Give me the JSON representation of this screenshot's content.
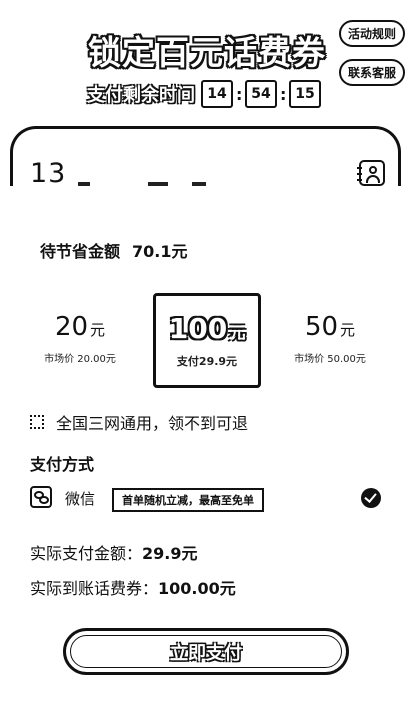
{
  "header": {
    "title": "锁定百元话费券",
    "rules_label": "活动规则",
    "service_label": "联系客服",
    "countdown_label": "支付剩余时间",
    "countdown": {
      "hours": "14",
      "minutes": "54",
      "seconds": "15"
    }
  },
  "phone": {
    "number_prefix": "13"
  },
  "savings": {
    "label": "待节省金额",
    "amount": "70.1元"
  },
  "options": [
    {
      "value": "20",
      "unit": "元",
      "sub": "市场价 20.00元"
    },
    {
      "value": "100",
      "unit": "元",
      "sub": "支付29.9元"
    },
    {
      "value": "50",
      "unit": "元",
      "sub": "市场价 50.00元"
    }
  ],
  "notice": "全国三网通用，领不到可退",
  "payment": {
    "title": "支付方式",
    "method": "微信",
    "promo": "首单随机立减，最高至免单"
  },
  "summary": {
    "actual_pay_label": "实际支付金额：",
    "actual_pay_value": "29.9元",
    "actual_receive_label": "实际到账话费券：",
    "actual_receive_value": "100.00元"
  },
  "pay_button": "立即支付"
}
